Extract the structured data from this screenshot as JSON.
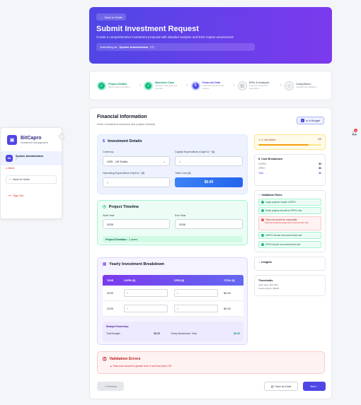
{
  "sidebar": {
    "brand": "BitCapro",
    "brand_sub": "Investment Management",
    "user_initials": "SA",
    "user_name": "System Administrator",
    "user_sub": "IT",
    "role": "Admin",
    "back_home": "Back to Home",
    "sign_out": "Sign Out"
  },
  "header": {
    "back_label": "Back to Drafts",
    "title": "Submit Investment Request",
    "subtitle": "Create a comprehensive investment proposal with detailed analysis and ESG impact assessment",
    "submitting_prefix": "Submitting as:",
    "submitting_user": "System Administrator",
    "submitting_dept": "(IT)"
  },
  "steps": [
    {
      "title": "Project Details",
      "desc": "Basic project information",
      "state": "done"
    },
    {
      "title": "Business Case",
      "desc": "Business case types and specifics",
      "state": "done"
    },
    {
      "title": "Financial Data",
      "desc": "Investment amounts and timeline",
      "state": "active"
    },
    {
      "title": "KPIs & Analysis",
      "desc": "Financial metrics and calculations",
      "state": "todo"
    },
    {
      "title": "Compliance",
      "desc": "Checklist and validation",
      "state": "todo"
    }
  ],
  "financial": {
    "title": "Financial Information",
    "subtitle": "Enter investment amounts and project timeline",
    "in_budget": "Is In Budget"
  },
  "investment": {
    "title": "Investment Details",
    "currency_label": "Currency",
    "currency_value": "USD - US Dollar",
    "capex_label": "Capital Expenditure (CapEx) * ($)",
    "capex_placeholder": "0",
    "opex_label": "Operating Expenditure (OpEx) * ($)",
    "opex_placeholder": "0",
    "total_label": "Total Cost ($)",
    "total_value": "$0.00"
  },
  "timeline": {
    "title": "Project Timeline",
    "start_label": "Start Year",
    "start_value": "2025",
    "end_label": "End Year",
    "end_value": "2026",
    "duration_label": "Project Duration:",
    "duration_value": "2 years"
  },
  "yearly": {
    "title": "Yearly Investment Breakdown",
    "headers": [
      "YEAR",
      "CAPEX ($)",
      "OPEX ($)",
      "TOTAL ($)"
    ],
    "rows": [
      {
        "year": "2025",
        "capex": "0",
        "opex": "0",
        "total": "$0.00"
      },
      {
        "year": "2026",
        "capex": "0",
        "opex": "0",
        "total": "$0.00"
      }
    ],
    "summary_title": "Budget Summary",
    "total_budget_label": "Total Budget:",
    "total_budget_value": "$0.00",
    "yearly_total_label": "Yearly Breakdown Total:",
    "yearly_total_value": "$0.00"
  },
  "rules_status": {
    "label": "1 rule failed",
    "count": "4/5",
    "progress": 0.8
  },
  "cost_breakdown": {
    "title": "Cost Breakdown",
    "rows": [
      {
        "label": "CAPEX",
        "value": "$0"
      },
      {
        "label": "OPEX",
        "value": "$0"
      },
      {
        "label": "Total",
        "value": "$0"
      }
    ]
  },
  "validation_rules": {
    "title": "Validation Rules",
    "items": [
      {
        "label": "Large projects require CAPEX",
        "status": "pass"
      },
      {
        "label": "Small projects should be OPEX only",
        "status": "pass"
      },
      {
        "label": "Total cost should be reasonable",
        "detail": "Total cost should be greater than 0 and less than 1T$",
        "status": "fail"
      },
      {
        "label": "CAPEX should not exceed total cost",
        "status": "pass"
      },
      {
        "label": "OPEX should not exceed total cost",
        "status": "pass"
      }
    ]
  },
  "insights": {
    "title": "Insights"
  },
  "thresholds": {
    "title": "Thresholds",
    "lines": [
      "High value: $10,000+",
      "Small projects: $500K-"
    ]
  },
  "errors": {
    "title": "Validation Errors",
    "items": [
      "Total cost should be greater than 0 and less than 1T$"
    ]
  },
  "footer": {
    "previous": "Previous",
    "save_draft": "Save as Draft",
    "next": "Next"
  },
  "notifications": {
    "count": "2"
  },
  "colors": {
    "primary": "#4f46e5",
    "success": "#10b981",
    "danger": "#ef4444",
    "warning": "#f59e0b"
  }
}
